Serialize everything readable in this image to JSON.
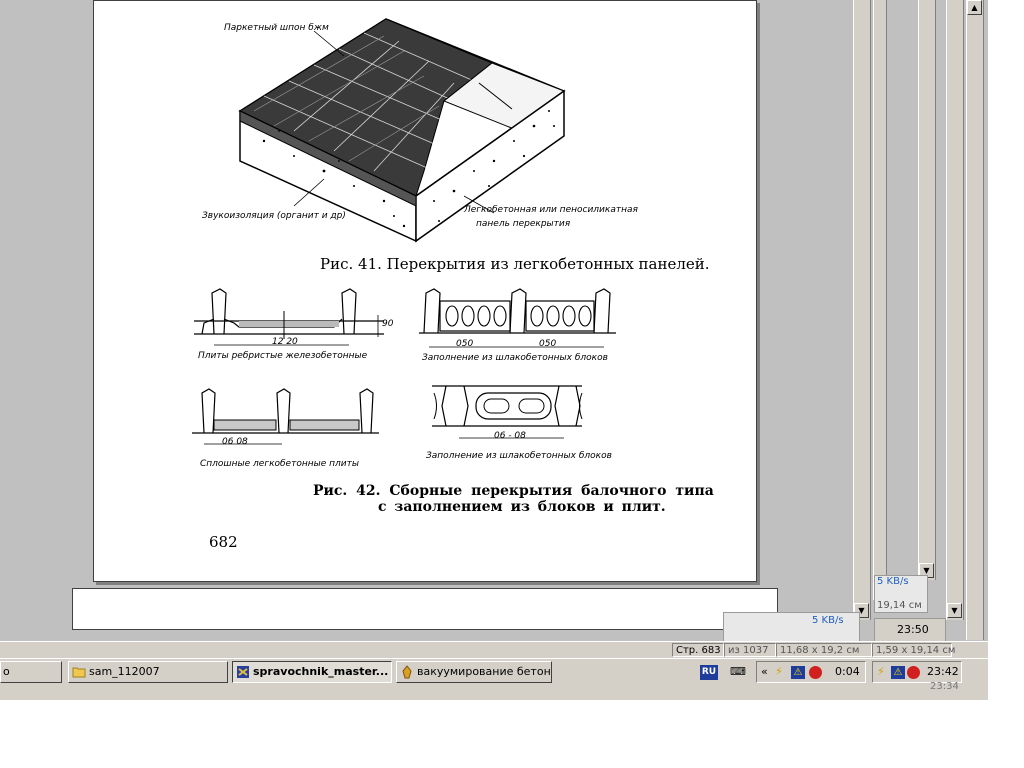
{
  "document": {
    "fig41_label_top": "Паркетный шпон бжм",
    "fig41_label_left": "Звукоизоляция (органит и др)",
    "fig41_label_right_1": "Легкобетонная или пеносиликатная",
    "fig41_label_right_2": "панель перекрытия",
    "fig41_caption": "Рис. 41. Перекрытия из легкобетонных панелей.",
    "fig42_a_dim_v": "90",
    "fig42_a_dim_h": "12 20",
    "fig42_a_label": "Плиты ребристые железобетонные",
    "fig42_b_dim_1": "050",
    "fig42_b_dim_2": "050",
    "fig42_b_label": "Заполнение из шлакобетонных блоков",
    "fig42_c_dim": "06 08",
    "fig42_c_label": "Сплошные легкобетонные плиты",
    "fig42_d_dim": "06 - 08",
    "fig42_d_label": "Заполнение из шлакобетонных блоков",
    "fig42_caption_1": "Рис. 42. Сборные перекрытия балочного типа",
    "fig42_caption_2": "с заполнением из блоков и плит.",
    "page_number": "682"
  },
  "statusbar": {
    "page_label": "Стр. 683",
    "page_of": "из 1037",
    "size": "11,68 x 19,2 см"
  },
  "ghost": {
    "speed_1": "5 KB/s",
    "speed_2": "5 KB/s",
    "size_1": "19,14 см",
    "size_2": "1,59 x 19,14 см",
    "time_1": "23:50",
    "time_2": "23:42",
    "time_3": "23:34",
    "time_4": "0:04"
  },
  "taskbar": {
    "btn_0": "о",
    "btn_1": "sam_112007",
    "btn_2": "spravochnik_master...",
    "btn_3": "вакуумирование бетон...",
    "lang": "RU",
    "tray_chevron": "«",
    "clock": "0:04"
  }
}
